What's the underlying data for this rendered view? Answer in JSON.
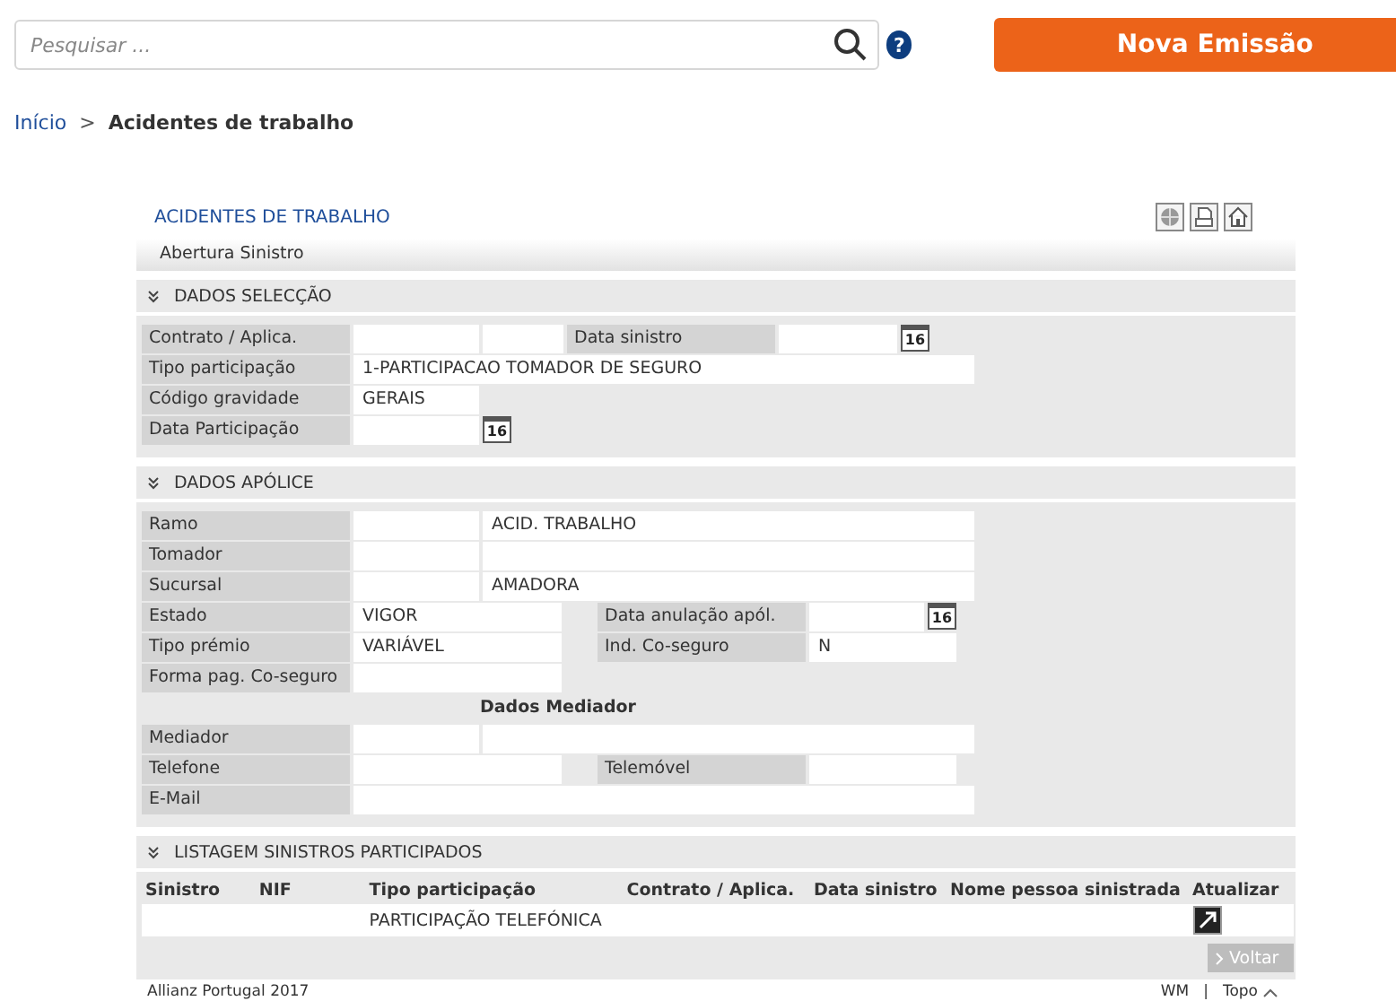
{
  "search": {
    "placeholder": "Pesquisar ..."
  },
  "help": "?",
  "new_button": "Nova Emissão",
  "breadcrumb": [
    {
      "kind": "link",
      "label": "Início"
    },
    {
      "kind": "separator",
      "label": ">"
    },
    {
      "kind": "current",
      "label": "Acidentes de trabalho"
    }
  ],
  "panel": {
    "title": "ACIDENTES DE TRABALHO",
    "subtitle": "Abertura Sinistro",
    "sections": [
      {
        "kind": "form",
        "title": "DADOS SELECÇÃO",
        "rows": [
          {
            "kind": "quad",
            "cells": [
              {
                "kind": "label",
                "text": "Contrato / Aplica."
              },
              {
                "kind": "value"
              },
              {
                "kind": "value"
              },
              {
                "kind": "label",
                "text": "Data sinistro"
              },
              {
                "kind": "date",
                "calendar": "16"
              }
            ]
          },
          {
            "kind": "wide",
            "cells": [
              {
                "kind": "label",
                "text": "Tipo participação"
              },
              {
                "kind": "value",
                "text": "1-PARTICIPACAO TOMADOR DE SEGURO"
              }
            ]
          },
          {
            "kind": "short",
            "cells": [
              {
                "kind": "label",
                "text": "Código gravidade"
              },
              {
                "kind": "value",
                "text": "GERAIS"
              }
            ]
          },
          {
            "kind": "shortdate",
            "cells": [
              {
                "kind": "label",
                "text": "Data Participação"
              },
              {
                "kind": "date",
                "calendar": "16"
              }
            ]
          }
        ]
      },
      {
        "kind": "form",
        "title": "DADOS APÓLICE",
        "rows": [
          {
            "kind": "pair",
            "cells": [
              {
                "kind": "label",
                "text": "Ramo"
              },
              {
                "kind": "value"
              },
              {
                "kind": "value",
                "text": "ACID. TRABALHO"
              }
            ]
          },
          {
            "kind": "pair",
            "cells": [
              {
                "kind": "label",
                "text": "Tomador"
              },
              {
                "kind": "value"
              },
              {
                "kind": "value"
              }
            ]
          },
          {
            "kind": "pair",
            "cells": [
              {
                "kind": "label",
                "text": "Sucursal"
              },
              {
                "kind": "value"
              },
              {
                "kind": "value",
                "text": "AMADORA"
              }
            ]
          },
          {
            "kind": "split",
            "cells": [
              {
                "kind": "label",
                "text": "Estado"
              },
              {
                "kind": "value",
                "text": "VIGOR"
              },
              {
                "kind": "label",
                "text": "Data anulação apól."
              },
              {
                "kind": "date",
                "calendar": "16"
              }
            ]
          },
          {
            "kind": "split",
            "cells": [
              {
                "kind": "label",
                "text": "Tipo prémio"
              },
              {
                "kind": "value",
                "text": "VARIÁVEL"
              },
              {
                "kind": "label",
                "text": "Ind. Co-seguro"
              },
              {
                "kind": "value",
                "text": "N"
              }
            ]
          },
          {
            "kind": "half",
            "cells": [
              {
                "kind": "label",
                "text": "Forma pag. Co-seguro"
              },
              {
                "kind": "value"
              }
            ]
          },
          {
            "kind": "heading",
            "cells": [
              {
                "kind": "heading",
                "text": "Dados Mediador"
              }
            ]
          },
          {
            "kind": "pair",
            "cells": [
              {
                "kind": "label",
                "text": "Mediador"
              },
              {
                "kind": "value"
              },
              {
                "kind": "value"
              }
            ]
          },
          {
            "kind": "split",
            "cells": [
              {
                "kind": "label",
                "text": "Telefone"
              },
              {
                "kind": "value"
              },
              {
                "kind": "label",
                "text": "Telemóvel"
              },
              {
                "kind": "value"
              }
            ]
          },
          {
            "kind": "wide",
            "cells": [
              {
                "kind": "label",
                "text": "E-Mail"
              },
              {
                "kind": "value"
              }
            ]
          }
        ]
      },
      {
        "kind": "table",
        "title": "LISTAGEM SINISTROS PARTICIPADOS",
        "columns": [
          "Sinistro",
          "NIF",
          "Tipo participação",
          "Contrato / Aplica.",
          "Data sinistro",
          "Nome pessoa sinistrada",
          "Atualizar"
        ],
        "rows": [
          {
            "cells": [
              {
                "kind": "blank"
              },
              {
                "kind": "blank"
              },
              {
                "kind": "text",
                "text": "PARTICIPAÇÃO TELEFÓNICA"
              },
              {
                "kind": "blank"
              },
              {
                "kind": "blank"
              },
              {
                "kind": "blank"
              },
              {
                "kind": "action"
              }
            ]
          }
        ]
      }
    ],
    "back_button": "Voltar"
  },
  "footer": {
    "copyright": "Allianz Portugal 2017",
    "links": [
      "WM",
      "Topo"
    ],
    "separator": "|"
  }
}
